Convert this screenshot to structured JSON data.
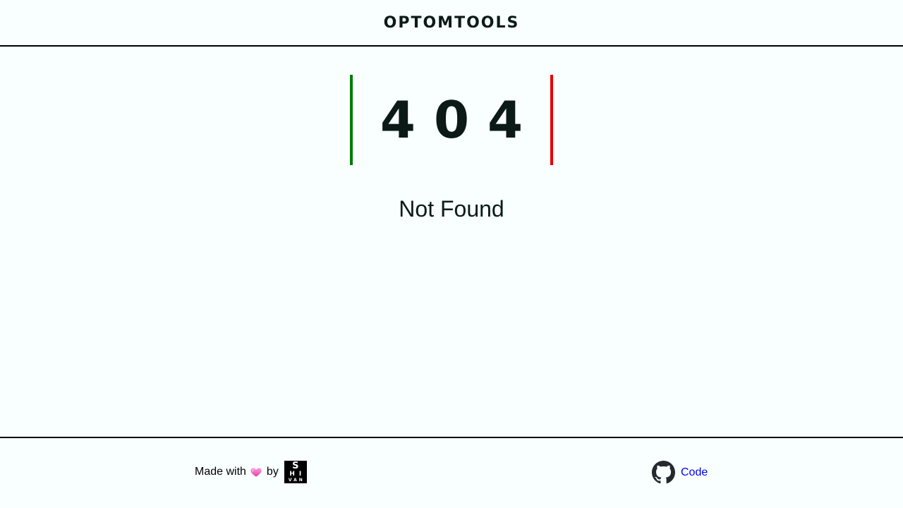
{
  "header": {
    "brand": "OPTOMTOOLS"
  },
  "error": {
    "code": "404",
    "message": "Not Found"
  },
  "footer": {
    "made_with": "Made with",
    "by": "by",
    "logo": {
      "row1": "S",
      "row2": "HI",
      "row3": "VAN"
    },
    "code_link": "Code"
  },
  "icons": {
    "heart": "heart-icon",
    "github": "github-icon"
  },
  "colors": {
    "background": "#f9ffff",
    "left_bar": "#007a00",
    "right_bar": "#e80000",
    "link": "#0000ee"
  }
}
